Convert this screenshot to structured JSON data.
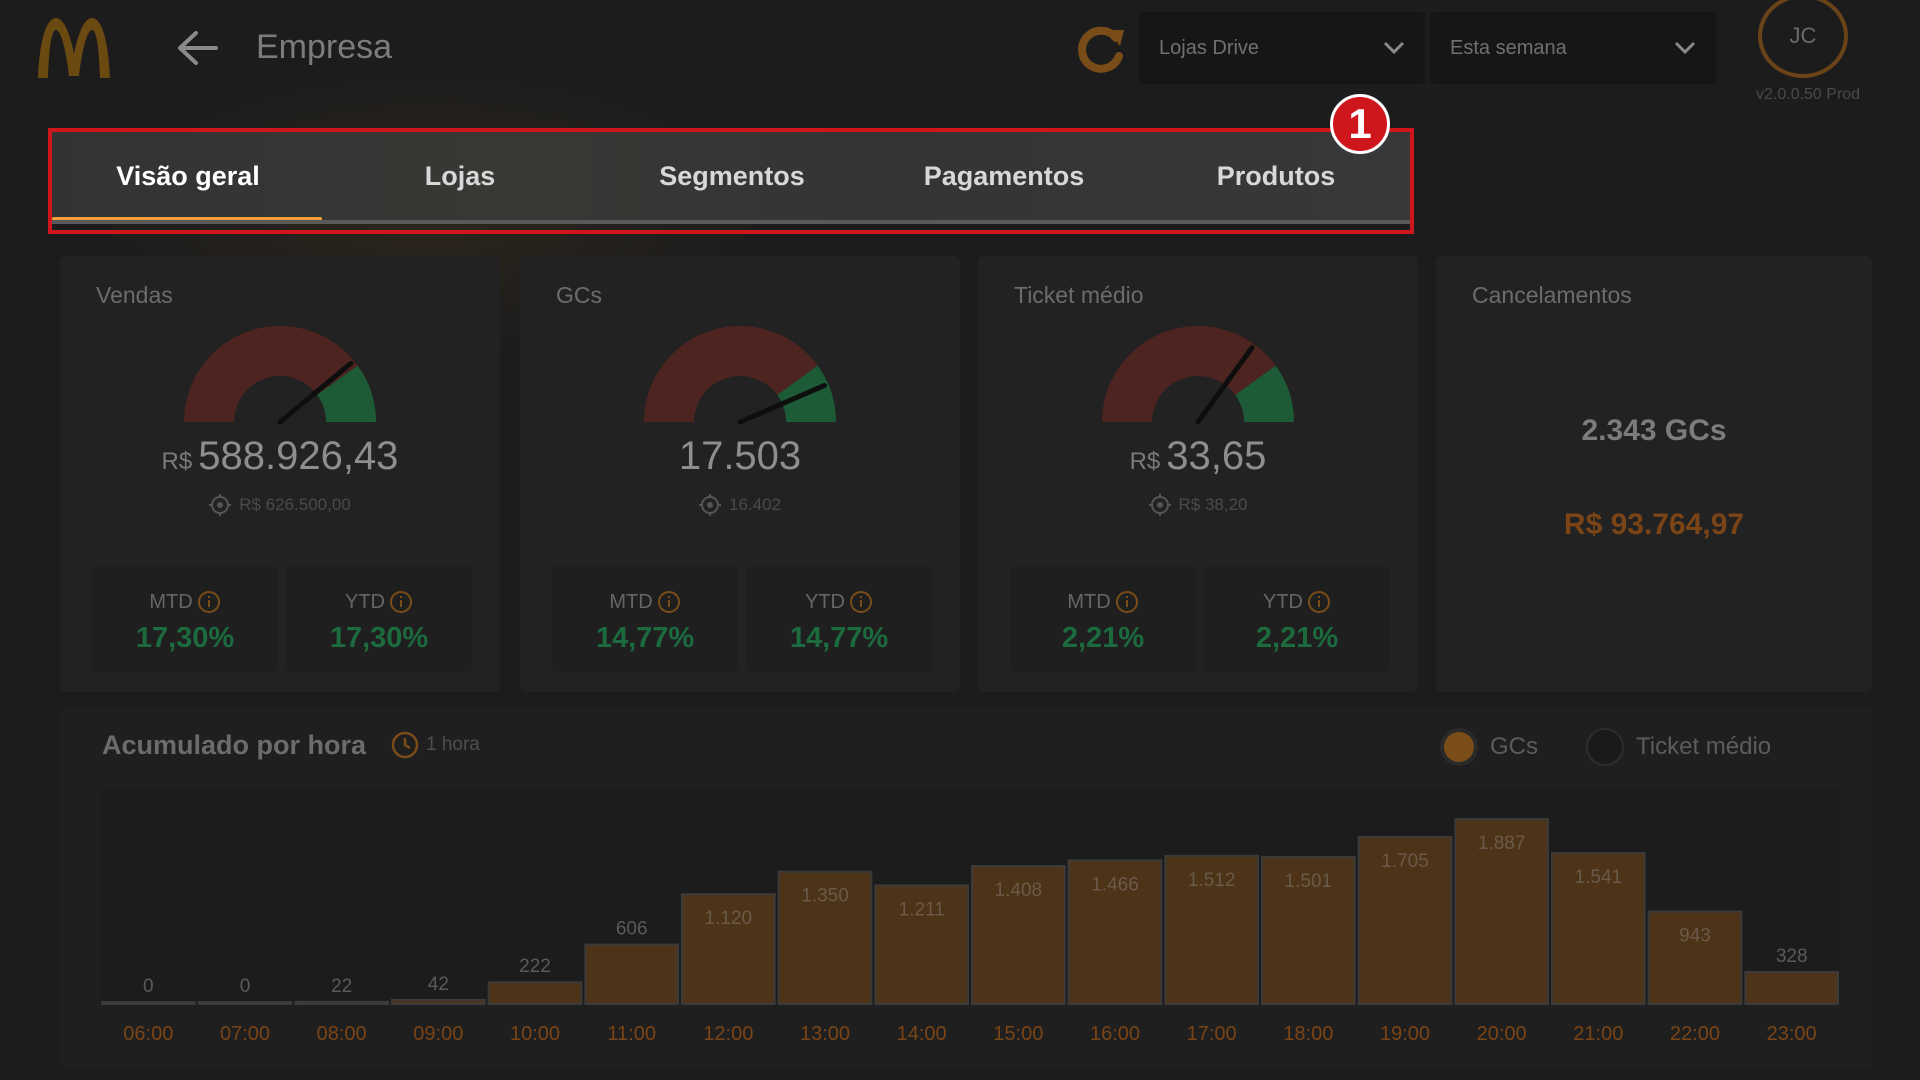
{
  "header": {
    "title": "Empresa",
    "store_filter": "Lojas Drive",
    "period_filter": "Esta semana",
    "avatar_initials": "JC",
    "version": "v2.0.0.50 Prod",
    "logo_color": "#6b4a12"
  },
  "tabs": [
    {
      "label": "Visão geral",
      "active": true
    },
    {
      "label": "Lojas",
      "active": false
    },
    {
      "label": "Segmentos",
      "active": false
    },
    {
      "label": "Pagamentos",
      "active": false
    },
    {
      "label": "Produtos",
      "active": false
    }
  ],
  "annotation_badge": "1",
  "cards": {
    "vendas": {
      "title": "Vendas",
      "currency": "R$",
      "value": "588.926,43",
      "target": "R$ 626.500,00",
      "gauge_fraction": 0.78,
      "mtd_label": "MTD",
      "mtd_value": "17,30%",
      "ytd_label": "YTD",
      "ytd_value": "17,30%"
    },
    "gcs": {
      "title": "GCs",
      "value": "17.503",
      "target": "16.402",
      "gauge_fraction": 0.87,
      "mtd_label": "MTD",
      "mtd_value": "14,77%",
      "ytd_label": "YTD",
      "ytd_value": "14,77%"
    },
    "ticket": {
      "title": "Ticket médio",
      "currency": "R$",
      "value": "33,65",
      "target": "R$ 38,20",
      "gauge_fraction": 0.7,
      "mtd_label": "MTD",
      "mtd_value": "2,21%",
      "ytd_label": "YTD",
      "ytd_value": "2,21%"
    },
    "cancelamentos": {
      "title": "Cancelamentos",
      "gcs": "2.343 GCs",
      "value": "R$ 93.764,97"
    }
  },
  "chart_panel": {
    "title": "Acumulado por hora",
    "interval": "1 hora",
    "legend_gcs": "GCs",
    "legend_ticket": "Ticket médio",
    "selected": "GCs"
  },
  "chart_data": {
    "type": "bar",
    "categories": [
      "06:00",
      "07:00",
      "08:00",
      "09:00",
      "10:00",
      "11:00",
      "12:00",
      "13:00",
      "14:00",
      "15:00",
      "16:00",
      "17:00",
      "18:00",
      "19:00",
      "20:00",
      "21:00",
      "22:00",
      "23:00"
    ],
    "values": [
      0,
      0,
      22,
      42,
      222,
      606,
      1120,
      1350,
      1211,
      1408,
      1466,
      1512,
      1501,
      1705,
      1887,
      1541,
      943,
      328
    ],
    "labels": [
      "0",
      "0",
      "22",
      "42",
      "222",
      "606",
      "1.120",
      "1.350",
      "1.211",
      "1.408",
      "1.466",
      "1.512",
      "1.501",
      "1.705",
      "1.887",
      "1.541",
      "943",
      "328"
    ],
    "ylim": [
      0,
      2000
    ],
    "bar_color": "#4d3318",
    "label_color": "#6a5a4a",
    "tick_color": "#7a4416"
  }
}
